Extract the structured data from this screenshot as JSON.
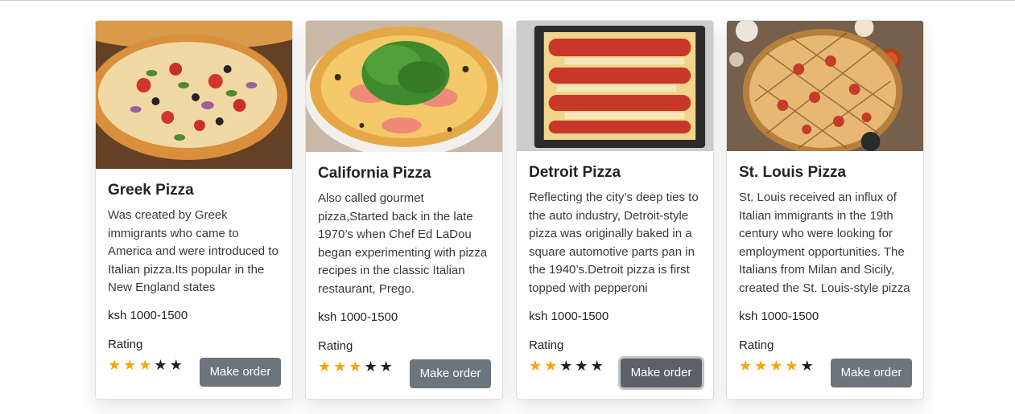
{
  "cards": [
    {
      "title": "Greek Pizza",
      "description": "Was created by Greek immigrants who came to America and were introduced to Italian pizza.Its popular in the New England states",
      "price": "ksh 1000-1500",
      "rating_label": "Rating",
      "rating": 3,
      "rating_max": 5,
      "button_label": "Make order"
    },
    {
      "title": "California Pizza",
      "description": "Also called gourmet pizza,Started back in the late 1970’s when Chef Ed LaDou began experimenting with pizza recipes in the classic Italian restaurant, Prego.",
      "price": "ksh 1000-1500",
      "rating_label": "Rating",
      "rating": 3,
      "rating_max": 5,
      "button_label": "Make order"
    },
    {
      "title": "Detroit Pizza",
      "description": "Reflecting the city’s deep ties to the auto industry, Detroit-style pizza was originally baked in a square automotive parts pan in the 1940’s.Detroit pizza is first topped with pepperoni",
      "price": "ksh 1000-1500",
      "rating_label": "Rating",
      "rating": 2,
      "rating_max": 5,
      "button_label": "Make order"
    },
    {
      "title": "St. Louis Pizza",
      "description": "St. Louis received an influx of Italian immigrants in the 19th century who were looking for employment opportunities. The Italians from Milan and Sicily, created the St. Louis-style pizza",
      "price": "ksh 1000-1500",
      "rating_label": "Rating",
      "rating": 4,
      "rating_max": 5,
      "button_label": "Make order"
    }
  ],
  "colors": {
    "star_filled": "#f5a60a",
    "star_empty": "#1d2124",
    "button_bg": "#6c757d"
  }
}
